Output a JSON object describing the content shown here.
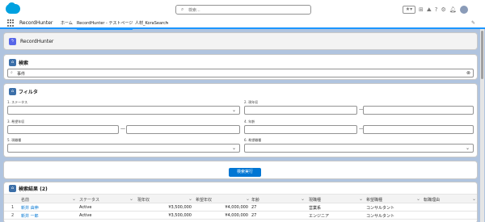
{
  "header": {
    "search_placeholder": "検索...",
    "icons": [
      "star-icon",
      "dropdown-icon",
      "add-icon",
      "trailhead-icon",
      "help-icon",
      "gear-icon",
      "bell-icon",
      "avatar"
    ]
  },
  "nav": {
    "app_name": "RecordHunter",
    "items": [
      {
        "label": "ホーム"
      },
      {
        "label": "RecordHunter - テストページ"
      },
      {
        "label": "人材_KoraSearch"
      }
    ]
  },
  "app_card": {
    "title": "RecordHunter"
  },
  "search_card": {
    "title": "検索",
    "value": "事件"
  },
  "filter_card": {
    "title": "フィルタ",
    "fields": [
      {
        "label": "1. ステータス"
      },
      {
        "label": "2. 現年収"
      },
      {
        "label": "3. 希望年収"
      },
      {
        "label": "4. 年齢"
      },
      {
        "label": "5. 現職種"
      },
      {
        "label": "6. 希望職種"
      }
    ],
    "range_sep": "—"
  },
  "action": {
    "search_button": "検索実行"
  },
  "results": {
    "title": "検索結果 (2)",
    "columns": [
      "名前",
      "ステータス",
      "現年収",
      "希望年収",
      "年齢",
      "現職種",
      "希望職種",
      "転職理由"
    ],
    "rows": [
      {
        "num": "1",
        "name": "新井 由伸",
        "status": "Active",
        "salary": "¥3,500,000",
        "desired_salary": "¥4,000,000",
        "age": "27",
        "job": "営業系",
        "desired_job": "コンサルタント",
        "reason": ""
      },
      {
        "num": "2",
        "name": "新井 一郎",
        "status": "Active",
        "salary": "¥3,500,000",
        "desired_salary": "¥4,000,000",
        "age": "27",
        "job": "エンジニア",
        "desired_job": "コンサルタント",
        "reason": ""
      }
    ]
  },
  "colors": {
    "brand": "#00a1e0",
    "accent": "#0176d3",
    "icon_bg": "#3c6fa8"
  }
}
